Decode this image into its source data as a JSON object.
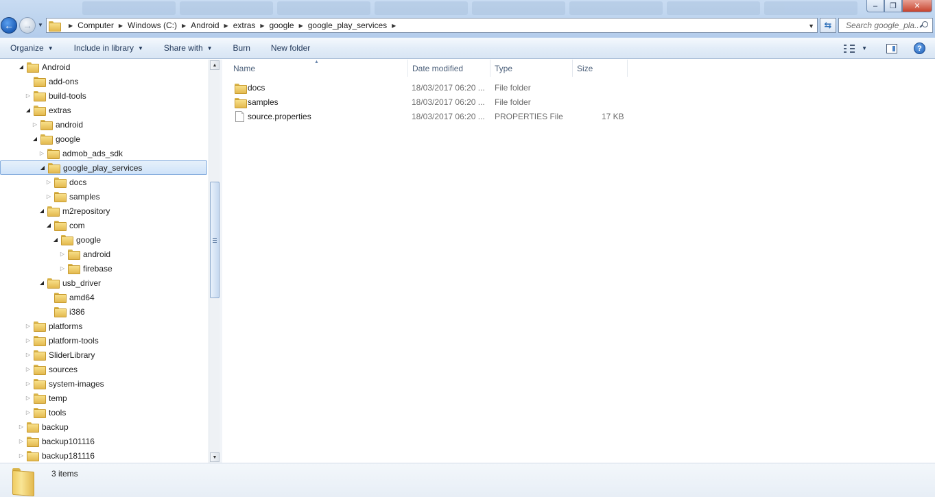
{
  "window": {
    "controls": {
      "minimize": "–",
      "maximize": "❐",
      "close": "✕"
    }
  },
  "address": {
    "crumbs": [
      "Computer",
      "Windows (C:)",
      "Android",
      "extras",
      "google",
      "google_play_services"
    ]
  },
  "search": {
    "placeholder": "Search google_pla..."
  },
  "toolbar": {
    "organize": "Organize",
    "include_in_library": "Include in library",
    "share_with": "Share with",
    "burn": "Burn",
    "new_folder": "New folder"
  },
  "tree": [
    {
      "label": "Android",
      "level": 0,
      "state": "open"
    },
    {
      "label": "add-ons",
      "level": 1,
      "state": "none"
    },
    {
      "label": "build-tools",
      "level": 1,
      "state": "closed"
    },
    {
      "label": "extras",
      "level": 1,
      "state": "open"
    },
    {
      "label": "android",
      "level": 2,
      "state": "closed"
    },
    {
      "label": "google",
      "level": 2,
      "state": "open"
    },
    {
      "label": "admob_ads_sdk",
      "level": 3,
      "state": "closed"
    },
    {
      "label": "google_play_services",
      "level": 3,
      "state": "open",
      "selected": true
    },
    {
      "label": "docs",
      "level": 4,
      "state": "closed"
    },
    {
      "label": "samples",
      "level": 4,
      "state": "closed"
    },
    {
      "label": "m2repository",
      "level": 3,
      "state": "open"
    },
    {
      "label": "com",
      "level": 4,
      "state": "open"
    },
    {
      "label": "google",
      "level": 5,
      "state": "open"
    },
    {
      "label": "android",
      "level": 6,
      "state": "closed"
    },
    {
      "label": "firebase",
      "level": 6,
      "state": "closed"
    },
    {
      "label": "usb_driver",
      "level": 3,
      "state": "open"
    },
    {
      "label": "amd64",
      "level": 4,
      "state": "none"
    },
    {
      "label": "i386",
      "level": 4,
      "state": "none"
    },
    {
      "label": "platforms",
      "level": 1,
      "state": "closed"
    },
    {
      "label": "platform-tools",
      "level": 1,
      "state": "closed"
    },
    {
      "label": "SliderLibrary",
      "level": 1,
      "state": "closed"
    },
    {
      "label": "sources",
      "level": 1,
      "state": "closed"
    },
    {
      "label": "system-images",
      "level": 1,
      "state": "closed"
    },
    {
      "label": "temp",
      "level": 1,
      "state": "closed"
    },
    {
      "label": "tools",
      "level": 1,
      "state": "closed"
    },
    {
      "label": "backup",
      "level": 0,
      "state": "closed"
    },
    {
      "label": "backup101116",
      "level": 0,
      "state": "closed"
    },
    {
      "label": "backup181116",
      "level": 0,
      "state": "closed"
    }
  ],
  "columns": {
    "name": "Name",
    "date_modified": "Date modified",
    "type": "Type",
    "size": "Size"
  },
  "files": [
    {
      "name": "docs",
      "date": "18/03/2017 06:20 ...",
      "type": "File folder",
      "size": "",
      "kind": "folder"
    },
    {
      "name": "samples",
      "date": "18/03/2017 06:20 ...",
      "type": "File folder",
      "size": "",
      "kind": "folder"
    },
    {
      "name": "source.properties",
      "date": "18/03/2017 06:20 ...",
      "type": "PROPERTIES File",
      "size": "17 KB",
      "kind": "file"
    }
  ],
  "status": {
    "item_count": "3 items"
  }
}
